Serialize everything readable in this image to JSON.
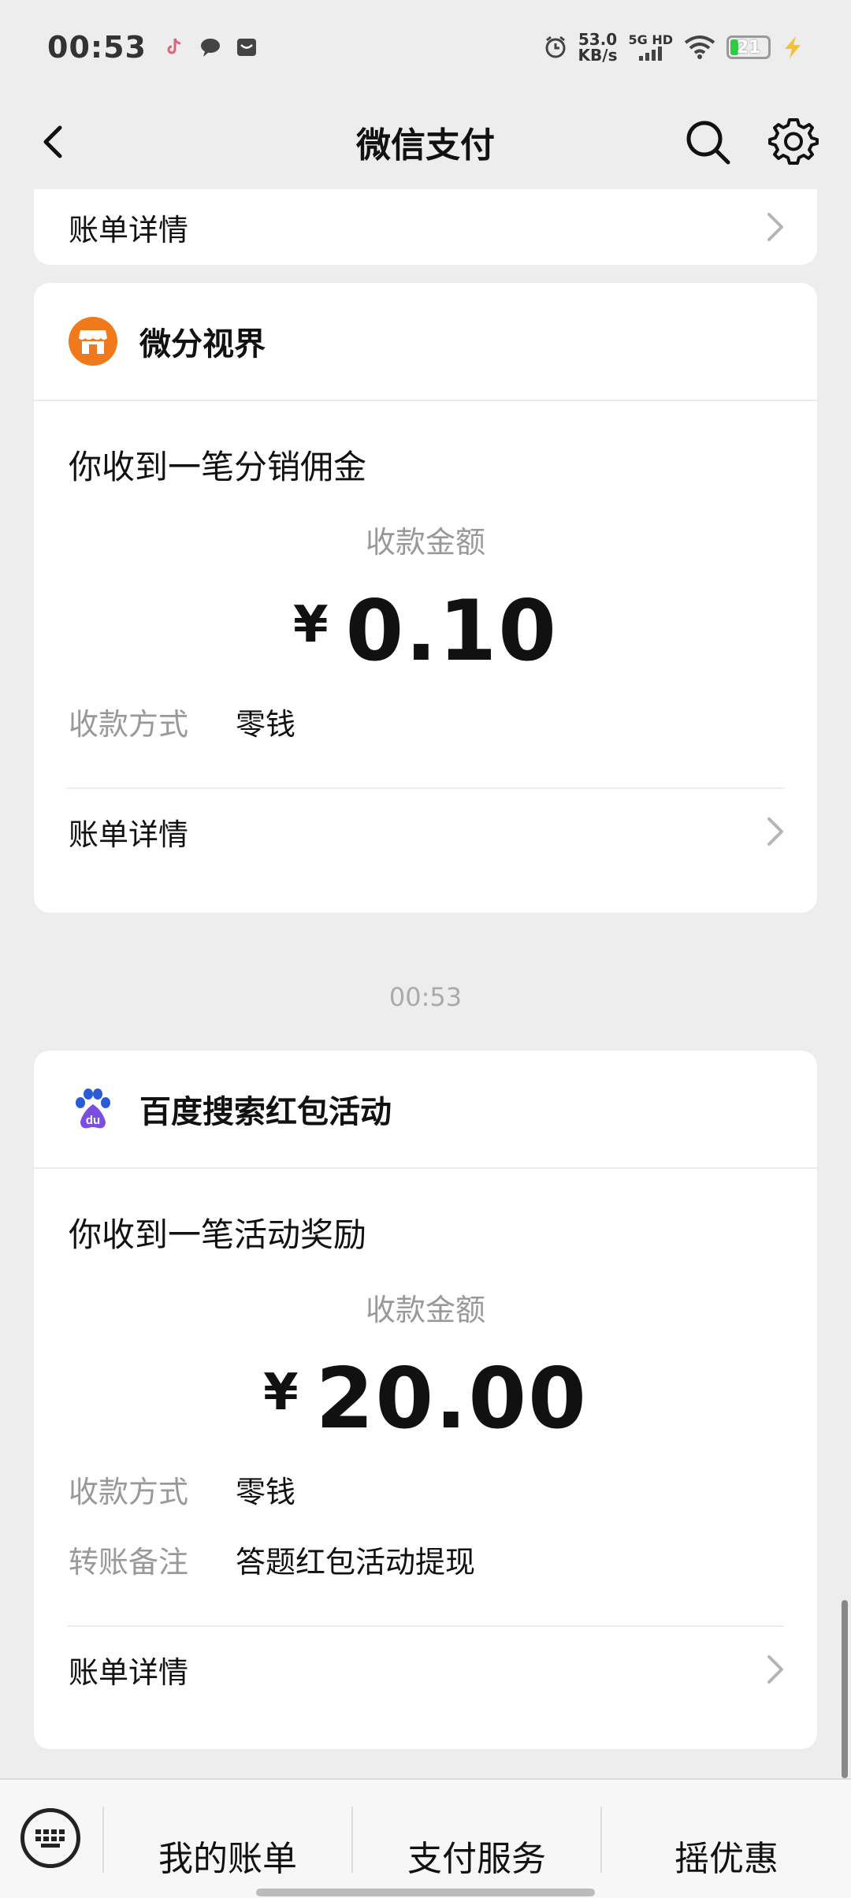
{
  "status": {
    "time": "00:53",
    "net_speed_value": "53.0",
    "net_speed_unit": "KB/s",
    "network": "5G HD",
    "battery": "21"
  },
  "nav": {
    "title": "微信支付"
  },
  "top_card": {
    "detail_label": "账单详情"
  },
  "card1": {
    "brand": "微分视界",
    "headline": "你收到一笔分销佣金",
    "amount_label": "收款金额",
    "currency": "¥",
    "amount": "0.10",
    "method_key": "收款方式",
    "method_value": "零钱",
    "detail_label": "账单详情"
  },
  "timestamp": "00:53",
  "card2": {
    "brand": "百度搜索红包活动",
    "headline": "你收到一笔活动奖励",
    "amount_label": "收款金额",
    "currency": "¥",
    "amount": "20.00",
    "method_key": "收款方式",
    "method_value": "零钱",
    "remark_key": "转账备注",
    "remark_value": "答题红包活动提现",
    "detail_label": "账单详情"
  },
  "bottom": {
    "item1": "我的账单",
    "item2": "支付服务",
    "item3": "摇优惠"
  },
  "colors": {
    "brand1": "#f07a1b",
    "baidu_blue": "#2a5bd7",
    "baidu_purple": "#7b4de0"
  }
}
